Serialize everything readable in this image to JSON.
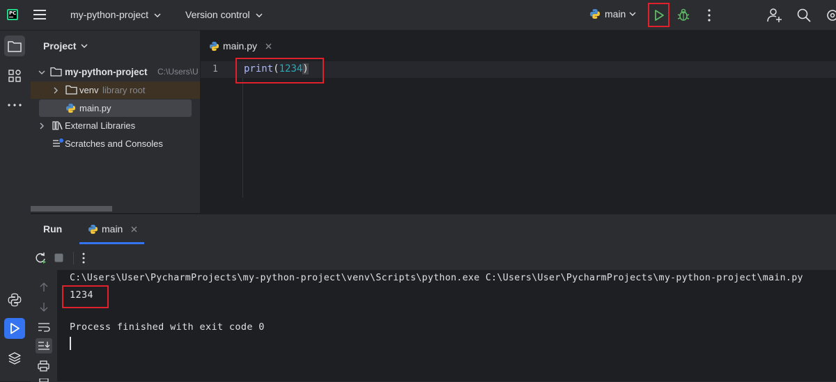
{
  "app": {
    "logo_text": "PC",
    "project_name": "my-python-project",
    "vcs_label": "Version control",
    "run_config": "main"
  },
  "project_panel": {
    "title": "Project",
    "items": [
      {
        "label": "my-python-project",
        "hint": "C:\\Users\\U"
      },
      {
        "label": "venv",
        "hint": "library root"
      },
      {
        "label": "main.py",
        "hint": ""
      },
      {
        "label": "External Libraries",
        "hint": ""
      },
      {
        "label": "Scratches and Consoles",
        "hint": ""
      }
    ]
  },
  "editor": {
    "tab_label": "main.py",
    "line_number": "1",
    "code": {
      "func": "print",
      "open": "(",
      "arg": "1234",
      "close": ")"
    }
  },
  "run_panel": {
    "title": "Run",
    "tab_label": "main",
    "console_lines": [
      "C:\\Users\\User\\PycharmProjects\\my-python-project\\venv\\Scripts\\python.exe C:\\Users\\User\\PycharmProjects\\my-python-project\\main.py",
      "1234",
      "",
      "Process finished with exit code 0"
    ]
  },
  "colors": {
    "accent": "#3574f0",
    "run_green": "#5fb865",
    "highlight_red": "#e0202a",
    "number_teal": "#2aacb8",
    "func_purple": "#a9b7ff"
  }
}
